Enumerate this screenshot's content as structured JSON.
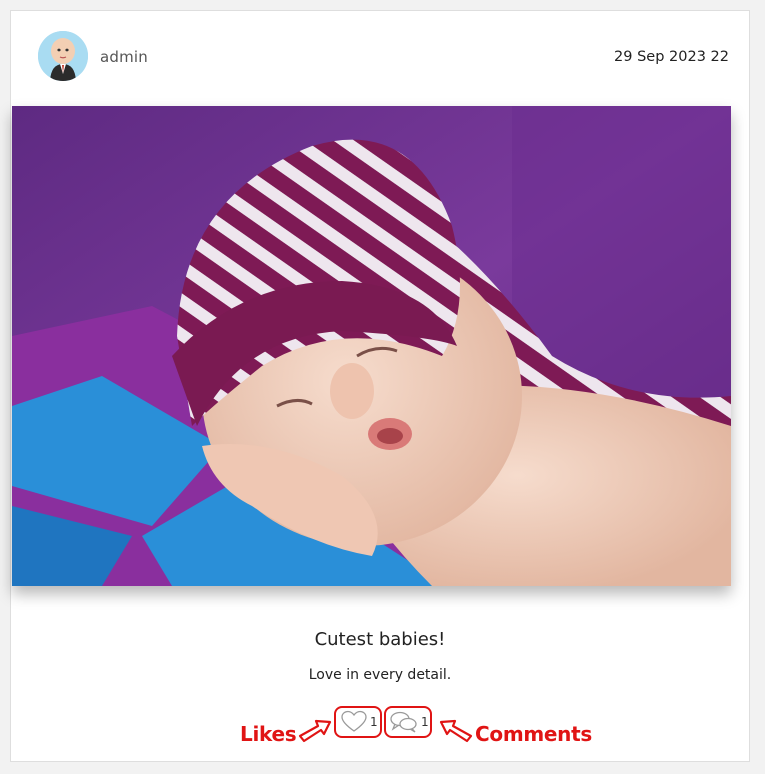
{
  "post": {
    "author": "admin",
    "date": "29 Sep 2023 22",
    "title": "Cutest babies!",
    "description": "Love in every detail.",
    "likes_count": "1",
    "comments_count": "1"
  },
  "annotations": {
    "likes_label": "Likes",
    "comments_label": "Comments"
  },
  "colors": {
    "annotation": "#e01414",
    "photo_background": "#6a2a88",
    "hat_stripe": "#7e1a55",
    "blanket_blue": "#2a8fd8"
  },
  "icons": {
    "like": "heart-icon",
    "comment": "speech-bubbles-icon"
  }
}
